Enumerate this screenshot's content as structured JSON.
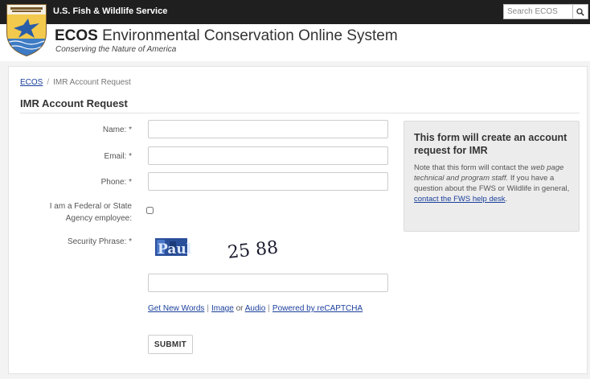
{
  "header": {
    "agency_name": "U.S. Fish & Wildlife Service",
    "site_abbr": "ECOS",
    "site_name": "Environmental Conservation Online System",
    "tagline": "Conserving the Nature of America",
    "search_placeholder": "Search ECOS",
    "search_icon": "magnifier-icon"
  },
  "breadcrumb": {
    "home": "ECOS",
    "separator": "/",
    "current": "IMR Account Request"
  },
  "page_title": "IMR Account Request",
  "form": {
    "name_label": "Name: *",
    "email_label": "Email: *",
    "phone_label": "Phone: *",
    "agency_label": "I am a Federal or State Agency employee:",
    "security_label": "Security Phrase: *",
    "name_value": "",
    "email_value": "",
    "phone_value": "",
    "security_value": "",
    "agency_checked": false,
    "captcha_word1": "Paul",
    "captcha_word2": "25 88",
    "get_new_words": "Get New Words",
    "image": "Image",
    "or": "or",
    "audio": "Audio",
    "powered": "Powered by reCAPTCHA",
    "pipe": "|",
    "submit_label": "SUBMIT"
  },
  "info_panel": {
    "heading": "This form will create an account request for IMR",
    "text_1": "Note that this form will contact the ",
    "text_2_italic": "web page technical and program staff.",
    "text_3": " If you have a question about the FWS or Wildlife in general, ",
    "link": "contact the FWS help desk",
    "text_4": "."
  },
  "colors": {
    "topbar": "#1f1f1f",
    "link": "#1a3f9b",
    "panel": "#ececec"
  }
}
